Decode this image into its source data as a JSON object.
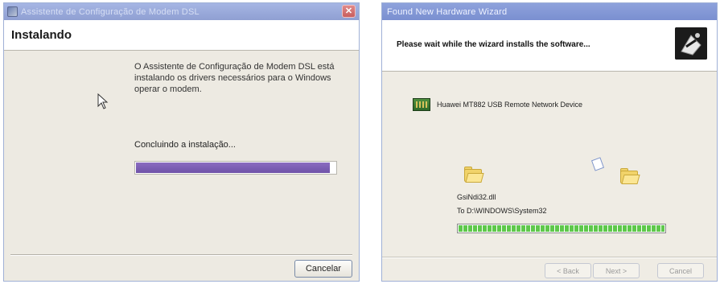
{
  "left_window": {
    "title": "Assistente de Configuração de Modem DSL",
    "close_glyph": "✕",
    "heading": "Instalando",
    "message": "O Assistente de Configuração de Modem DSL está instalando os drivers necessários para o Windows operar o modem.",
    "status": "Concluindo a instalação...",
    "progress_percent": 97,
    "cancel_label": "Cancelar",
    "colors": {
      "titlebar": "#8f9fd2",
      "progress": "#6f52a8"
    }
  },
  "right_window": {
    "title": "Found New Hardware Wizard",
    "heading": "Please wait while the wizard installs the software...",
    "device_name": "Huawei MT882 USB Remote Network Device",
    "file_name": "GsiNdi32.dll",
    "file_destination": "To D:\\WINDOWS\\System32",
    "progress_percent": 100,
    "buttons": {
      "back": "< Back",
      "next": "Next >",
      "cancel": "Cancel"
    },
    "icons": [
      "wizard-icon",
      "network-device-icon",
      "source-folder-icon",
      "flying-file-icon",
      "destination-folder-icon"
    ],
    "colors": {
      "titlebar": "#7a8fd0",
      "progress": "#5ec84b"
    }
  }
}
